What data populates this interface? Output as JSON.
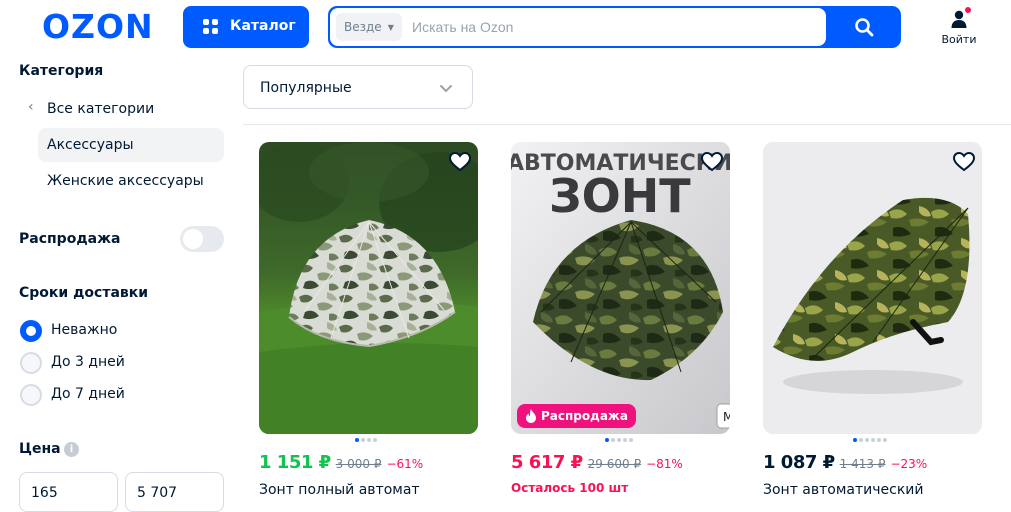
{
  "header": {
    "logo": "OZON",
    "catalog_label": "Каталог",
    "search_scope": "Везде",
    "search_placeholder": "Искать на Ozon",
    "login_label": "Войти",
    "brand_color": "#005bff"
  },
  "sidebar": {
    "category_title": "Категория",
    "categories": [
      {
        "label": "Все категории",
        "back": true
      },
      {
        "label": "Аксессуары",
        "active": true
      },
      {
        "label": "Женские аксессуары"
      }
    ],
    "sale_title": "Распродажа",
    "sale_enabled": false,
    "delivery_title": "Сроки доставки",
    "delivery_options": [
      {
        "label": "Неважно",
        "selected": true
      },
      {
        "label": "До 3 дней",
        "selected": false
      },
      {
        "label": "До 7 дней",
        "selected": false
      }
    ],
    "price_title": "Цена",
    "price_from": "165",
    "price_to": "5 707"
  },
  "sort": {
    "label": "Популярные"
  },
  "products": [
    {
      "price": "1 151 ₽",
      "old_price": "3 000 ₽",
      "discount": "−61%",
      "price_color": "#10c44c",
      "name": "Зонт полный автомат",
      "image_dots": 4,
      "image_text": ""
    },
    {
      "price": "5 617 ₽",
      "old_price": "29 600 ₽",
      "discount": "−81%",
      "price_color": "#f91155",
      "stock": "Осталось 100 шт",
      "badge": "Распродажа",
      "image_dots": 5,
      "image_text_top": "АВТОМАТИЧЕСКИЙ",
      "image_text_big": "ЗОНТ"
    },
    {
      "price": "1 087 ₽",
      "old_price": "1 413 ₽",
      "discount": "−23%",
      "price_color": "#001a34",
      "name": "Зонт автоматический",
      "image_dots": 6
    }
  ]
}
